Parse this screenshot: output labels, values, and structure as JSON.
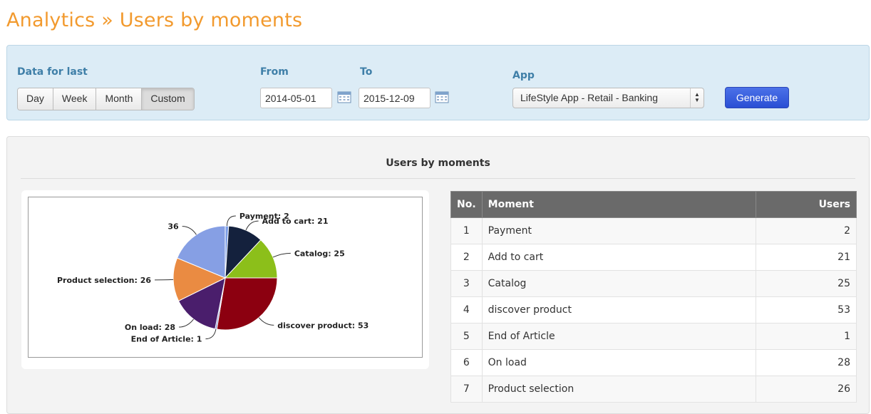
{
  "header": {
    "title": "Analytics » Users by moments"
  },
  "filters": {
    "data_for_last_label": "Data for last",
    "periods": [
      "Day",
      "Week",
      "Month",
      "Custom"
    ],
    "active_period": "Custom",
    "from_label": "From",
    "from_value": "2014-05-01",
    "to_label": "To",
    "to_value": "2015-12-09",
    "app_label": "App",
    "app_value": "LifeStyle App - Retail - Banking",
    "generate_label": "Generate",
    "accent_color": "#2a4fd4"
  },
  "panel": {
    "title": "Users by moments"
  },
  "chart_data": {
    "type": "pie",
    "slices": [
      {
        "label": "Payment",
        "value": 2,
        "color": "#7b9de6",
        "display": "Payment:    2"
      },
      {
        "label": "Add to cart",
        "value": 21,
        "color": "#14213d",
        "display": "Add to cart: 21"
      },
      {
        "label": "Catalog",
        "value": 25,
        "color": "#8cbf1a",
        "display": "Catalog: 25"
      },
      {
        "label": "discover product",
        "value": 53,
        "color": "#8c0010",
        "display": "discover product: 53"
      },
      {
        "label": "End of Article",
        "value": 1,
        "color": "#7e8fd4",
        "display": "End of Article: 1"
      },
      {
        "label": "On load",
        "value": 28,
        "color": "#4a1e6c",
        "display": "On load: 28"
      },
      {
        "label": "Product selection",
        "value": 26,
        "color": "#ea8b42",
        "display": "Product selection: 26"
      },
      {
        "label": "",
        "value": 36,
        "color": "#869fe4",
        "display": "36"
      }
    ]
  },
  "table": {
    "columns": [
      "No.",
      "Moment",
      "Users"
    ],
    "rows": [
      [
        "1",
        "Payment",
        "2"
      ],
      [
        "2",
        "Add to cart",
        "21"
      ],
      [
        "3",
        "Catalog",
        "25"
      ],
      [
        "4",
        "discover product",
        "53"
      ],
      [
        "5",
        "End of Article",
        "1"
      ],
      [
        "6",
        "On load",
        "28"
      ],
      [
        "7",
        "Product selection",
        "26"
      ]
    ]
  }
}
